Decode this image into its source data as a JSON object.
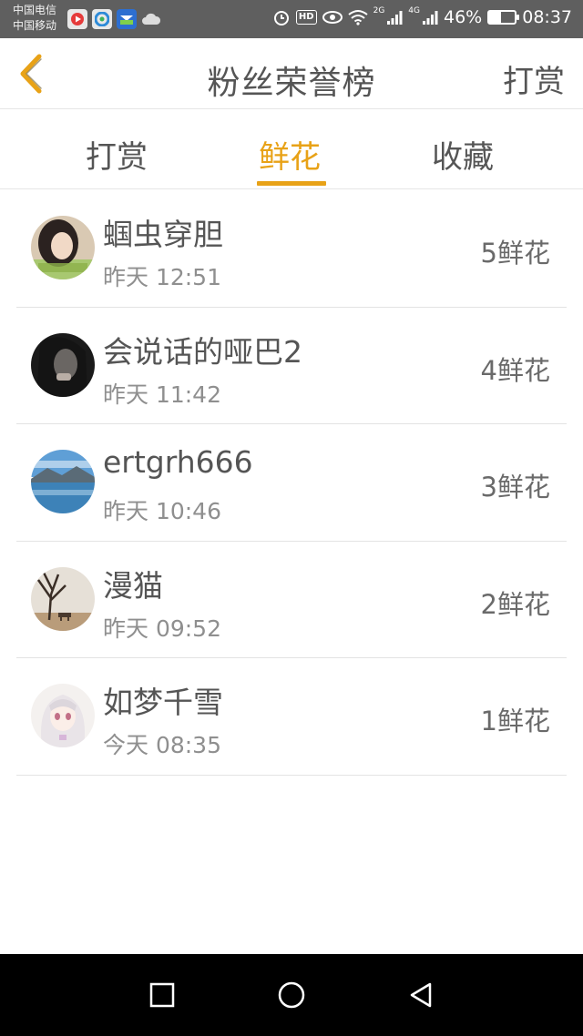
{
  "status_bar": {
    "carrier_1": "中国电信",
    "carrier_2": "中国移动",
    "hd": "HD",
    "net_2g": "2G",
    "net_4g": "4G",
    "battery": "46%",
    "time": "08:37",
    "battery_level": 0.46
  },
  "header": {
    "title": "粉丝荣誉榜",
    "action": "打赏"
  },
  "tabs": [
    "打赏",
    "鲜花",
    "收藏"
  ],
  "active_tab": 1,
  "colors": {
    "accent": "#e8a217",
    "text": "#555555",
    "subtext": "#8f8f8f"
  },
  "list": [
    {
      "name": "蝈虫穿胆",
      "time": "昨天 12:51",
      "amount": "5鲜花",
      "avatar_icon": "girl-portrait"
    },
    {
      "name": "会说话的哑巴2",
      "time": "昨天 11:42",
      "amount": "4鲜花",
      "avatar_icon": "dark-portrait"
    },
    {
      "name": "ertgrh666",
      "time": "昨天 10:46",
      "amount": "3鲜花",
      "avatar_icon": "lake-landscape"
    },
    {
      "name": "漫猫",
      "time": "昨天 09:52",
      "amount": "2鲜花",
      "avatar_icon": "tree-bench"
    },
    {
      "name": "如梦千雪",
      "time": "今天 08:35",
      "amount": "1鲜花",
      "avatar_icon": "anime-girl"
    }
  ],
  "nav": [
    "recent-apps-icon",
    "home-icon",
    "back-triangle-icon"
  ]
}
